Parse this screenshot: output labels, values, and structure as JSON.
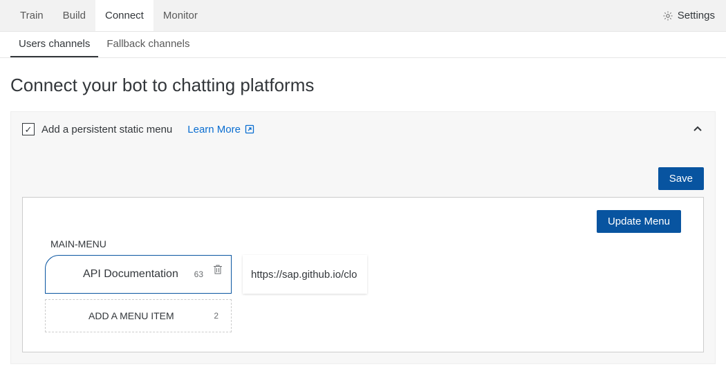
{
  "topTabs": {
    "train": "Train",
    "build": "Build",
    "connect": "Connect",
    "monitor": "Monitor"
  },
  "settings": "Settings",
  "subTabs": {
    "usersChannels": "Users channels",
    "fallbackChannels": "Fallback channels"
  },
  "pageTitle": "Connect your bot to chatting platforms",
  "panel": {
    "checkboxLabel": "Add a persistent static menu",
    "learnMore": "Learn More",
    "saveButton": "Save"
  },
  "menuEditor": {
    "updateButton": "Update Menu",
    "title": "MAIN-MENU",
    "item": {
      "label": "API Documentation",
      "charCount": "63",
      "url": "https://sap.github.io/clo"
    },
    "addItem": {
      "label": "ADD A MENU ITEM",
      "count": "2"
    }
  }
}
